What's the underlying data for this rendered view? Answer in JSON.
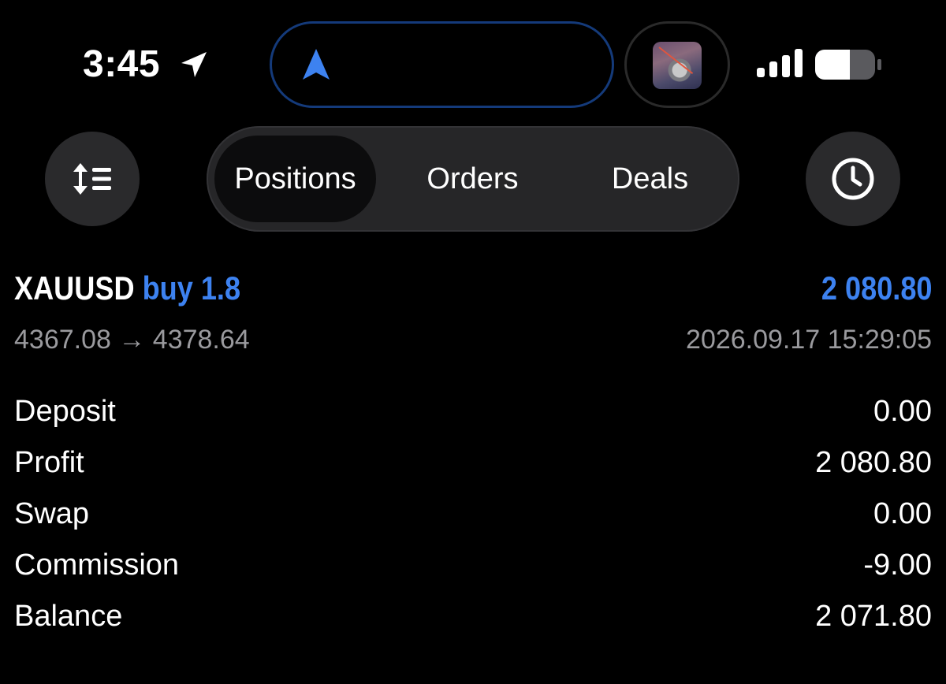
{
  "status_bar": {
    "time": "3:45",
    "icons": [
      "location-arrow-icon",
      "navigation-arrow-icon",
      "signal-icon",
      "battery-icon"
    ],
    "accent_color": "#3d82f0"
  },
  "toolbar": {
    "sort_icon": "sort-icon",
    "history_icon": "clock-icon",
    "tabs": [
      {
        "label": "Positions",
        "active": true
      },
      {
        "label": "Orders",
        "active": false
      },
      {
        "label": "Deals",
        "active": false
      }
    ]
  },
  "position": {
    "symbol": "XAUUSD",
    "side": "buy 1.8",
    "profit": "2 080.80",
    "prices": "4367.08 → 4378.64",
    "time": "2026.09.17 15:29:05"
  },
  "details": [
    {
      "label": "Deposit",
      "value": "0.00"
    },
    {
      "label": "Profit",
      "value": "2 080.80"
    },
    {
      "label": "Swap",
      "value": "0.00"
    },
    {
      "label": "Commission",
      "value": "-9.00"
    },
    {
      "label": "Balance",
      "value": "2 071.80"
    }
  ]
}
